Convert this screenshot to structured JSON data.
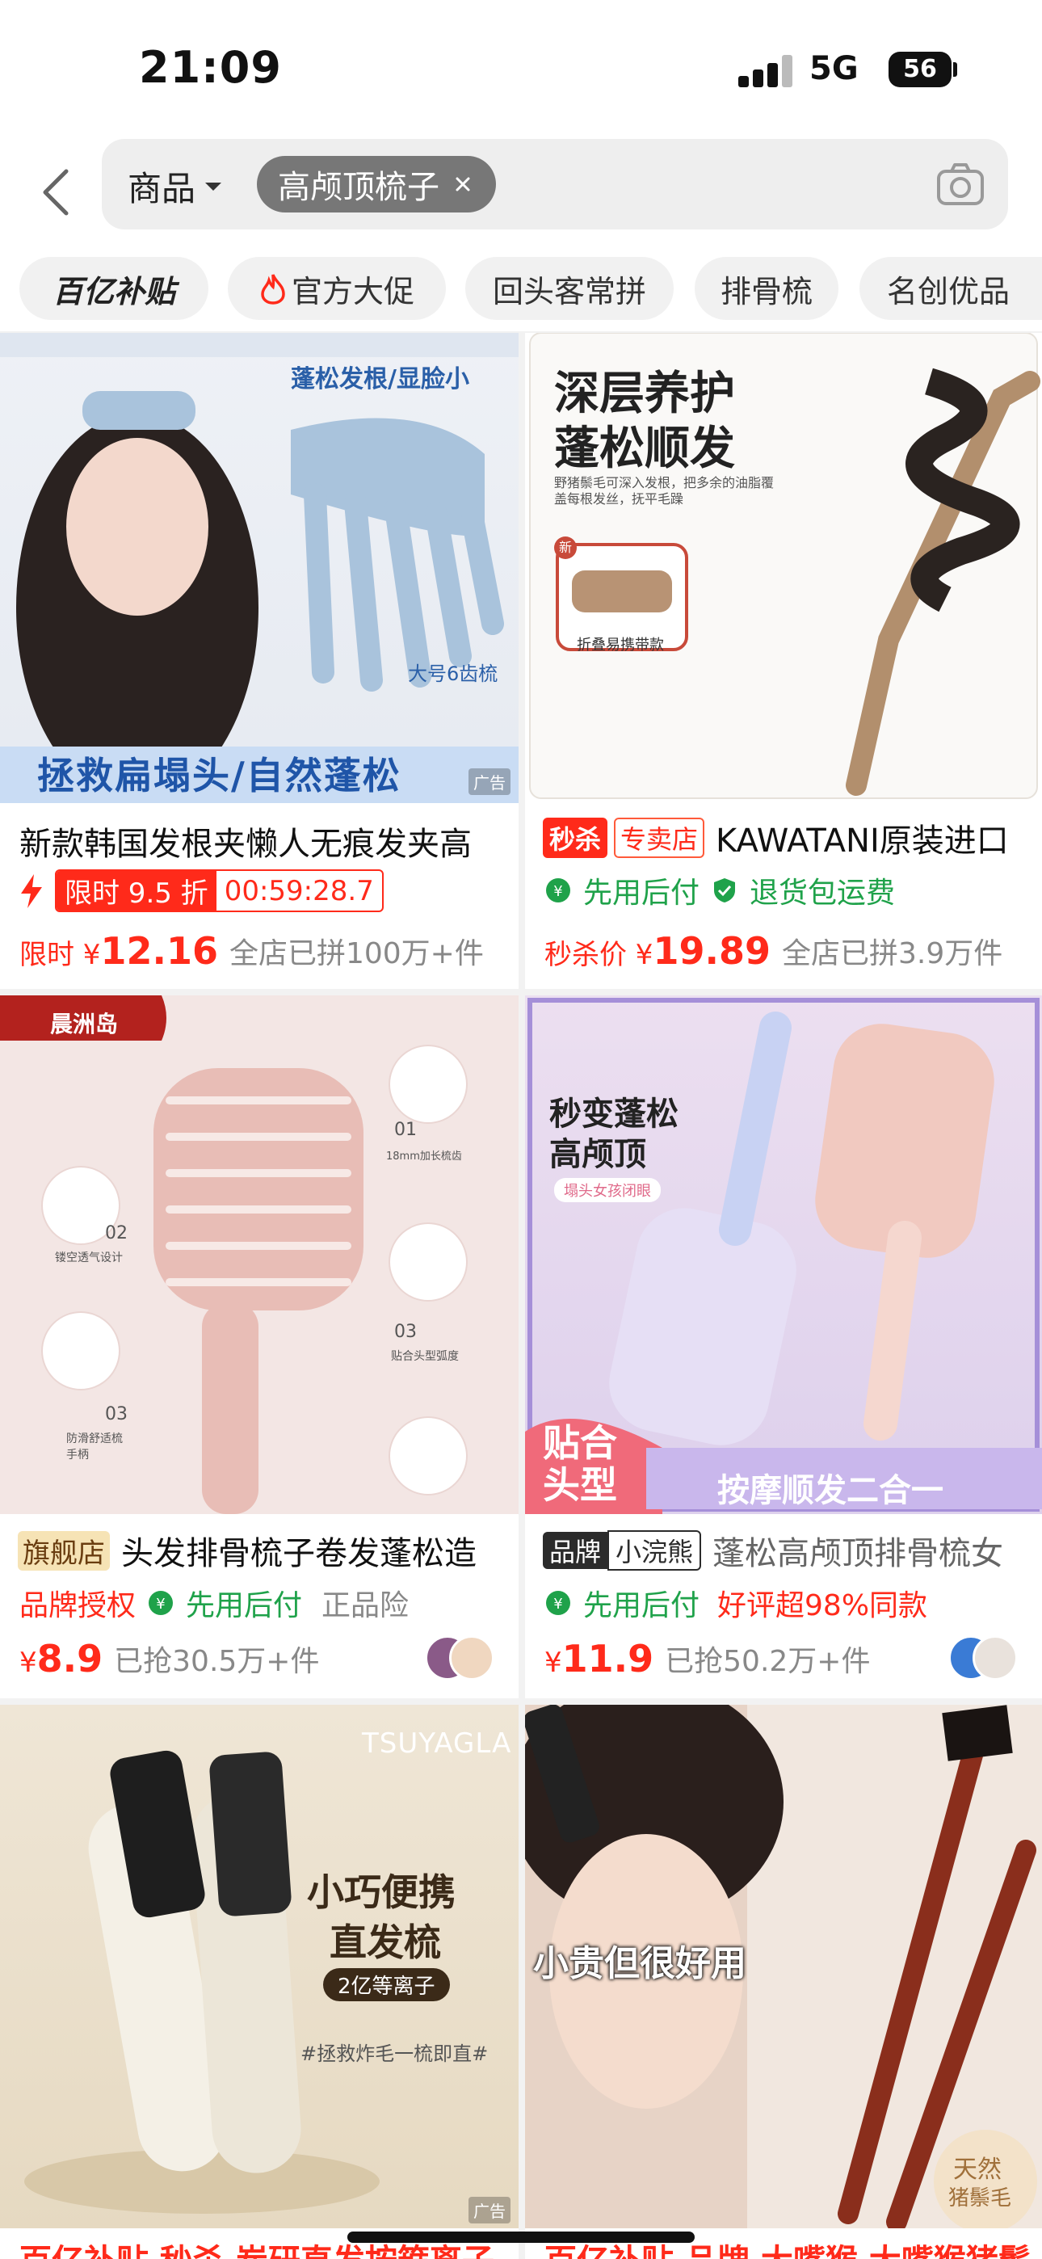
{
  "status_bar": {
    "time": "21:09",
    "network": "5G",
    "battery": "56"
  },
  "search": {
    "scope_label": "商品",
    "query": "高颅顶梳子"
  },
  "filters": [
    {
      "label": "百亿补贴"
    },
    {
      "label": "官方大促"
    },
    {
      "label": "回头客常拼"
    },
    {
      "label": "排骨梳"
    },
    {
      "label": "名创优品"
    }
  ],
  "products": [
    {
      "image_text": [
        "蓬松发根/显脸小",
        "大号6齿梳",
        "拯救扁塌头/自然蓬松"
      ],
      "ad_label": "广告",
      "title": "新款韩国发根夹懒人无痕发夹高",
      "flash_label": "限时 9.5 折",
      "countdown": "00:59:28.7",
      "price_prefix": "限时 ¥",
      "price": "12.16",
      "sales": "全店已拼100万+件"
    },
    {
      "image_text": [
        "深层养护",
        "蓬松顺发",
        "野猪鬃毛可深入发根，把多余的油脂覆盖每根发丝，抚平毛躁",
        "新",
        "折叠易携带款"
      ],
      "badge_1": "秒杀",
      "badge_2": "专卖店",
      "title": "KAWATANI原装进口",
      "service_1": "先用后付",
      "service_2": "退货包运费",
      "price_prefix": "秒杀价 ¥",
      "price": "19.89",
      "sales": "全店已拼3.9万件"
    },
    {
      "image_text": [
        "晨洲岛",
        "01",
        "18mm加长梳齿",
        "02",
        "镂空透气设计",
        "03",
        "贴合头型弧度",
        "03",
        "防滑舒适梳手柄"
      ],
      "badge": "旗舰店",
      "title": "头发排骨梳子卷发蓬松造",
      "service_1": "品牌授权",
      "service_2": "先用后付",
      "service_3": "正品险",
      "price_prefix": "¥",
      "price": "8.9",
      "sales": "已抢30.5万+件"
    },
    {
      "image_text": [
        "秒变蓬松",
        "高颅顶",
        "塌头女孩闭眼",
        "贴合",
        "头型",
        "按摩顺发二合一"
      ],
      "badge_1": "品牌",
      "badge_2": "小浣熊",
      "title": "蓬松高颅顶排骨梳女",
      "service_1": "先用后付",
      "service_2": "好评超98%同款",
      "price_prefix": "¥",
      "price": "11.9",
      "sales": "已抢50.2万+件"
    },
    {
      "image_text": [
        "TSUYAGLA",
        "小巧便携",
        "直发梳",
        "2亿等离子",
        "#拯救炸毛一梳即直#"
      ],
      "ad_label": "广告",
      "bottom_title": "百亿补贴 秒杀 炭研直发按箍离子"
    },
    {
      "image_text": [
        "小贵但很好用",
        "天然",
        "猪鬃毛"
      ],
      "bottom_title": "百亿补贴 品牌 大嘴猴 大嘴猴猪鬃"
    }
  ],
  "colors": {
    "accent_red": "#ff2a1a",
    "service_green": "#1fa24a",
    "chip_gray": "#777777"
  }
}
